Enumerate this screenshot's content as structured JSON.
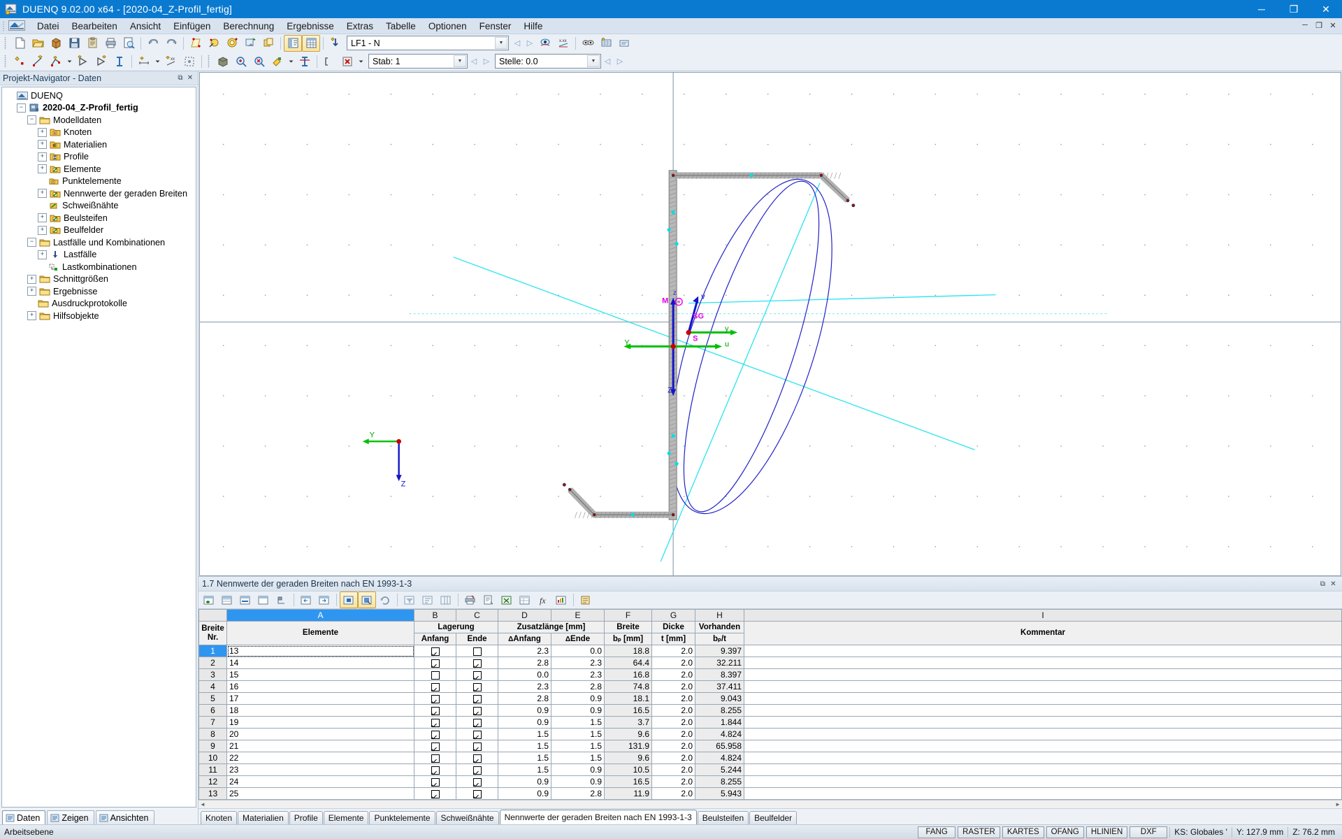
{
  "window": {
    "title": "DUENQ 9.02.00 x64 - [2020-04_Z-Profil_fertig]",
    "minimize": "─",
    "maximize": "❐",
    "close": "✕",
    "mdi_minimize": "─",
    "mdi_restore": "❐",
    "mdi_close": "✕"
  },
  "menu": {
    "items": [
      {
        "label": "Datei"
      },
      {
        "label": "Bearbeiten"
      },
      {
        "label": "Ansicht"
      },
      {
        "label": "Einfügen"
      },
      {
        "label": "Berechnung"
      },
      {
        "label": "Ergebnisse"
      },
      {
        "label": "Extras"
      },
      {
        "label": "Tabelle"
      },
      {
        "label": "Optionen"
      },
      {
        "label": "Fenster"
      },
      {
        "label": "Hilfe"
      }
    ]
  },
  "toolbar_row1": {
    "loadcase_value": "LF1 - N",
    "prev": "◁",
    "next": "▷"
  },
  "toolbar_row2": {
    "member_label": "Stab: 1",
    "location_label": "Stelle: 0.0",
    "prev": "◁",
    "next": "▷"
  },
  "navigator": {
    "caption": "Projekt-Navigator - Daten",
    "pin": "⧉",
    "close": "✕",
    "tree": [
      {
        "label": "DUENQ",
        "indent": 0,
        "expander": "none",
        "icon": "duenq-logo-icon",
        "bold": false
      },
      {
        "label": "2020-04_Z-Profil_fertig",
        "indent": 1,
        "expander": "minus",
        "icon": "model-icon",
        "bold": true
      },
      {
        "label": "Modelldaten",
        "indent": 2,
        "expander": "minus",
        "icon": "folder-icon",
        "bold": false
      },
      {
        "label": "Knoten",
        "indent": 3,
        "expander": "plus",
        "icon": "node-icon",
        "bold": false
      },
      {
        "label": "Materialien",
        "indent": 3,
        "expander": "plus",
        "icon": "material-icon",
        "bold": false
      },
      {
        "label": "Profile",
        "indent": 3,
        "expander": "plus",
        "icon": "profile-icon",
        "bold": false
      },
      {
        "label": "Elemente",
        "indent": 3,
        "expander": "plus",
        "icon": "element-icon",
        "bold": false
      },
      {
        "label": "Punktelemente",
        "indent": 3,
        "expander": "none",
        "icon": "point-element-icon",
        "bold": false
      },
      {
        "label": "Nennwerte der geraden Breiten",
        "indent": 3,
        "expander": "plus",
        "icon": "element-icon",
        "bold": false
      },
      {
        "label": "Schweißnähte",
        "indent": 3,
        "expander": "none",
        "icon": "weld-icon",
        "bold": false
      },
      {
        "label": "Beulsteifen",
        "indent": 3,
        "expander": "plus",
        "icon": "element-icon",
        "bold": false
      },
      {
        "label": "Beulfelder",
        "indent": 3,
        "expander": "plus",
        "icon": "element-icon",
        "bold": false
      },
      {
        "label": "Lastfälle und Kombinationen",
        "indent": 2,
        "expander": "minus",
        "icon": "folder-icon",
        "bold": false
      },
      {
        "label": "Lastfälle",
        "indent": 3,
        "expander": "plus",
        "icon": "loadcase-icon",
        "bold": false
      },
      {
        "label": "Lastkombinationen",
        "indent": 3,
        "expander": "none",
        "icon": "loadcombo-icon",
        "bold": false
      },
      {
        "label": "Schnittgrößen",
        "indent": 2,
        "expander": "plus",
        "icon": "folder-icon",
        "bold": false
      },
      {
        "label": "Ergebnisse",
        "indent": 2,
        "expander": "plus",
        "icon": "folder-icon",
        "bold": false
      },
      {
        "label": "Ausdruckprotokolle",
        "indent": 2,
        "expander": "none",
        "icon": "folder-icon",
        "bold": false
      },
      {
        "label": "Hilfsobjekte",
        "indent": 2,
        "expander": "plus",
        "icon": "folder-icon",
        "bold": false
      }
    ],
    "tabs": [
      {
        "label": "Daten",
        "icon": "data-icon",
        "selected": true
      },
      {
        "label": "Zeigen",
        "icon": "show-icon",
        "selected": false
      },
      {
        "label": "Ansichten",
        "icon": "views-icon",
        "selected": false
      }
    ]
  },
  "graphics": {
    "axis_labels": {
      "global_y": "Y",
      "global_z": "Z",
      "local_y": "y",
      "local_z": "z",
      "principal_u": "u",
      "principal_v": "v",
      "shear_center": "M",
      "centroid_sg": "SG",
      "centroid_s": "S"
    },
    "origin_y": "Y",
    "origin_z": "Z"
  },
  "table_panel": {
    "caption": "1.7 Nennwerte der geraden Breiten nach EN 1993-1-3",
    "pin": "⧉",
    "close": "✕",
    "columns": [
      {
        "letter": "A",
        "selected": true
      },
      {
        "letter": "B",
        "selected": false
      },
      {
        "letter": "C",
        "selected": false
      },
      {
        "letter": "D",
        "selected": false
      },
      {
        "letter": "E",
        "selected": false
      },
      {
        "letter": "F",
        "selected": false
      },
      {
        "letter": "G",
        "selected": false
      },
      {
        "letter": "H",
        "selected": false
      },
      {
        "letter": "I",
        "selected": false
      }
    ],
    "headers": {
      "rownum_line1": "Breite",
      "rownum_line2": "Nr.",
      "elements": "Elemente",
      "lagerung_group": "Lagerung",
      "lagerung_anfang": "Anfang",
      "lagerung_ende": "Ende",
      "zusatz_group": "Zusatzlänge [mm]",
      "zusatz_anfang": "ΔAnfang",
      "zusatz_ende": "ΔEnde",
      "breite_line1": "Breite",
      "breite_line2": "bₚ [mm]",
      "dicke_line1": "Dicke",
      "dicke_line2": "t [mm]",
      "vorhanden_line1": "Vorhanden",
      "vorhanden_line2": "bₚ/t",
      "kommentar": "Kommentar"
    },
    "rows": [
      {
        "nr": "1",
        "elemente": "13",
        "anfang": true,
        "ende": false,
        "d_anfang": "2.3",
        "d_ende": "0.0",
        "bp": "18.8",
        "t": "2.0",
        "bpt": "9.397",
        "kommentar": ""
      },
      {
        "nr": "2",
        "elemente": "14",
        "anfang": true,
        "ende": true,
        "d_anfang": "2.8",
        "d_ende": "2.3",
        "bp": "64.4",
        "t": "2.0",
        "bpt": "32.211",
        "kommentar": ""
      },
      {
        "nr": "3",
        "elemente": "15",
        "anfang": false,
        "ende": true,
        "d_anfang": "0.0",
        "d_ende": "2.3",
        "bp": "16.8",
        "t": "2.0",
        "bpt": "8.397",
        "kommentar": ""
      },
      {
        "nr": "4",
        "elemente": "16",
        "anfang": true,
        "ende": true,
        "d_anfang": "2.3",
        "d_ende": "2.8",
        "bp": "74.8",
        "t": "2.0",
        "bpt": "37.411",
        "kommentar": ""
      },
      {
        "nr": "5",
        "elemente": "17",
        "anfang": true,
        "ende": true,
        "d_anfang": "2.8",
        "d_ende": "0.9",
        "bp": "18.1",
        "t": "2.0",
        "bpt": "9.043",
        "kommentar": ""
      },
      {
        "nr": "6",
        "elemente": "18",
        "anfang": true,
        "ende": true,
        "d_anfang": "0.9",
        "d_ende": "0.9",
        "bp": "16.5",
        "t": "2.0",
        "bpt": "8.255",
        "kommentar": ""
      },
      {
        "nr": "7",
        "elemente": "19",
        "anfang": true,
        "ende": true,
        "d_anfang": "0.9",
        "d_ende": "1.5",
        "bp": "3.7",
        "t": "2.0",
        "bpt": "1.844",
        "kommentar": ""
      },
      {
        "nr": "8",
        "elemente": "20",
        "anfang": true,
        "ende": true,
        "d_anfang": "1.5",
        "d_ende": "1.5",
        "bp": "9.6",
        "t": "2.0",
        "bpt": "4.824",
        "kommentar": ""
      },
      {
        "nr": "9",
        "elemente": "21",
        "anfang": true,
        "ende": true,
        "d_anfang": "1.5",
        "d_ende": "1.5",
        "bp": "131.9",
        "t": "2.0",
        "bpt": "65.958",
        "kommentar": ""
      },
      {
        "nr": "10",
        "elemente": "22",
        "anfang": true,
        "ende": true,
        "d_anfang": "1.5",
        "d_ende": "1.5",
        "bp": "9.6",
        "t": "2.0",
        "bpt": "4.824",
        "kommentar": ""
      },
      {
        "nr": "11",
        "elemente": "23",
        "anfang": true,
        "ende": true,
        "d_anfang": "1.5",
        "d_ende": "0.9",
        "bp": "10.5",
        "t": "2.0",
        "bpt": "5.244",
        "kommentar": ""
      },
      {
        "nr": "12",
        "elemente": "24",
        "anfang": true,
        "ende": true,
        "d_anfang": "0.9",
        "d_ende": "0.9",
        "bp": "16.5",
        "t": "2.0",
        "bpt": "8.255",
        "kommentar": ""
      },
      {
        "nr": "13",
        "elemente": "25",
        "anfang": true,
        "ende": true,
        "d_anfang": "0.9",
        "d_ende": "2.8",
        "bp": "11.9",
        "t": "2.0",
        "bpt": "5.943",
        "kommentar": ""
      }
    ],
    "tabs": [
      {
        "label": "Knoten",
        "selected": false
      },
      {
        "label": "Materialien",
        "selected": false
      },
      {
        "label": "Profile",
        "selected": false
      },
      {
        "label": "Elemente",
        "selected": false
      },
      {
        "label": "Punktelemente",
        "selected": false
      },
      {
        "label": "Schweißnähte",
        "selected": false
      },
      {
        "label": "Nennwerte der geraden Breiten nach EN 1993-1-3",
        "selected": true
      },
      {
        "label": "Beulsteifen",
        "selected": false
      },
      {
        "label": "Beulfelder",
        "selected": false
      }
    ]
  },
  "statusbar": {
    "left_text": "Arbeitsebene",
    "toggles": [
      {
        "label": "FANG"
      },
      {
        "label": "RASTER"
      },
      {
        "label": "KARTES"
      },
      {
        "label": "OFANG"
      },
      {
        "label": "HLINIEN"
      },
      {
        "label": "DXF"
      }
    ],
    "cs_label": "KS: Globales '",
    "y_value": "Y:  127.9 mm",
    "z_value": "Z:  76.2 mm"
  },
  "colors": {
    "title_blue": "#0a7ad1",
    "select_blue": "#2e96f0",
    "accent_gold": "#c8a13c",
    "profile_gray": "#9d9d9d",
    "node_red": "#b00000",
    "cyan": "#00e5f0",
    "green": "#00bb00",
    "blue_axis": "#1414c8",
    "magenta": "#e000e0"
  }
}
